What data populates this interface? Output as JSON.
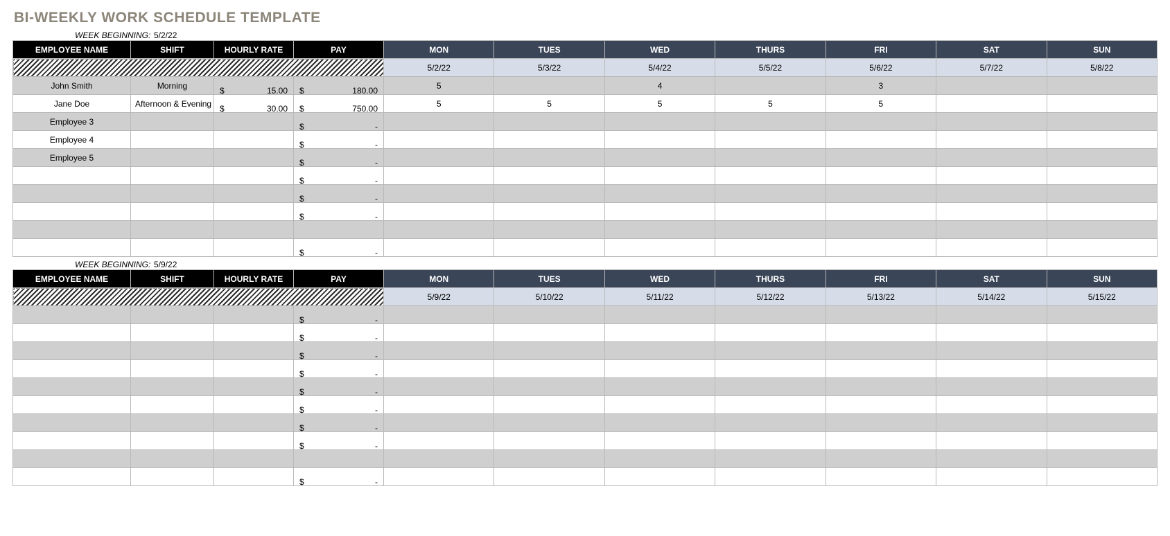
{
  "title": "BI-WEEKLY WORK SCHEDULE TEMPLATE",
  "week_beginning_label": "WEEK BEGINNING:",
  "currency_symbol": "$",
  "dash": "-",
  "columns": {
    "name": "EMPLOYEE NAME",
    "shift": "SHIFT",
    "rate": "HOURLY RATE",
    "pay": "PAY",
    "days": [
      "MON",
      "TUES",
      "WED",
      "THURS",
      "FRI",
      "SAT",
      "SUN"
    ]
  },
  "weeks": [
    {
      "begin": "5/2/22",
      "dates": [
        "5/2/22",
        "5/3/22",
        "5/4/22",
        "5/5/22",
        "5/6/22",
        "5/7/22",
        "5/8/22"
      ],
      "rows": [
        {
          "name": "John Smith",
          "shift": "Morning",
          "rate": "15.00",
          "pay": "180.00",
          "hours": [
            "5",
            "",
            "4",
            "",
            "3",
            "",
            ""
          ]
        },
        {
          "name": "Jane Doe",
          "shift": "Afternoon & Evening",
          "rate": "30.00",
          "pay": "750.00",
          "hours": [
            "5",
            "5",
            "5",
            "5",
            "5",
            "",
            ""
          ]
        },
        {
          "name": "Employee 3",
          "shift": "",
          "rate": "",
          "pay": "-",
          "hours": [
            "",
            "",
            "",
            "",
            "",
            "",
            ""
          ]
        },
        {
          "name": "Employee 4",
          "shift": "",
          "rate": "",
          "pay": "-",
          "hours": [
            "",
            "",
            "",
            "",
            "",
            "",
            ""
          ]
        },
        {
          "name": "Employee 5",
          "shift": "",
          "rate": "",
          "pay": "-",
          "hours": [
            "",
            "",
            "",
            "",
            "",
            "",
            ""
          ]
        },
        {
          "name": "",
          "shift": "",
          "rate": "",
          "pay": "-",
          "hours": [
            "",
            "",
            "",
            "",
            "",
            "",
            ""
          ]
        },
        {
          "name": "",
          "shift": "",
          "rate": "",
          "pay": "-",
          "hours": [
            "",
            "",
            "",
            "",
            "",
            "",
            ""
          ]
        },
        {
          "name": "",
          "shift": "",
          "rate": "",
          "pay": "-",
          "hours": [
            "",
            "",
            "",
            "",
            "",
            "",
            ""
          ]
        },
        {
          "name": "",
          "shift": "",
          "rate": "",
          "pay": "",
          "hours": [
            "",
            "",
            "",
            "",
            "",
            "",
            ""
          ]
        },
        {
          "name": "",
          "shift": "",
          "rate": "",
          "pay": "-",
          "hours": [
            "",
            "",
            "",
            "",
            "",
            "",
            ""
          ]
        }
      ]
    },
    {
      "begin": "5/9/22",
      "dates": [
        "5/9/22",
        "5/10/22",
        "5/11/22",
        "5/12/22",
        "5/13/22",
        "5/14/22",
        "5/15/22"
      ],
      "rows": [
        {
          "name": "",
          "shift": "",
          "rate": "",
          "pay": "-",
          "hours": [
            "",
            "",
            "",
            "",
            "",
            "",
            ""
          ]
        },
        {
          "name": "",
          "shift": "",
          "rate": "",
          "pay": "-",
          "hours": [
            "",
            "",
            "",
            "",
            "",
            "",
            ""
          ]
        },
        {
          "name": "",
          "shift": "",
          "rate": "",
          "pay": "-",
          "hours": [
            "",
            "",
            "",
            "",
            "",
            "",
            ""
          ]
        },
        {
          "name": "",
          "shift": "",
          "rate": "",
          "pay": "-",
          "hours": [
            "",
            "",
            "",
            "",
            "",
            "",
            ""
          ]
        },
        {
          "name": "",
          "shift": "",
          "rate": "",
          "pay": "-",
          "hours": [
            "",
            "",
            "",
            "",
            "",
            "",
            ""
          ]
        },
        {
          "name": "",
          "shift": "",
          "rate": "",
          "pay": "-",
          "hours": [
            "",
            "",
            "",
            "",
            "",
            "",
            ""
          ]
        },
        {
          "name": "",
          "shift": "",
          "rate": "",
          "pay": "-",
          "hours": [
            "",
            "",
            "",
            "",
            "",
            "",
            ""
          ]
        },
        {
          "name": "",
          "shift": "",
          "rate": "",
          "pay": "-",
          "hours": [
            "",
            "",
            "",
            "",
            "",
            "",
            ""
          ]
        },
        {
          "name": "",
          "shift": "",
          "rate": "",
          "pay": "",
          "hours": [
            "",
            "",
            "",
            "",
            "",
            "",
            ""
          ]
        },
        {
          "name": "",
          "shift": "",
          "rate": "",
          "pay": "-",
          "hours": [
            "",
            "",
            "",
            "",
            "",
            "",
            ""
          ]
        }
      ]
    }
  ]
}
